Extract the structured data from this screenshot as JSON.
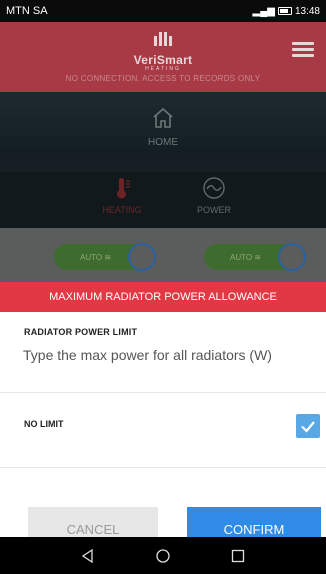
{
  "status_bar": {
    "carrier": "MTN SA",
    "time": "13:48"
  },
  "header": {
    "brand": "VeriSmart",
    "brand_sub": "HEATING",
    "offline_message": "NO CONNECTION. ACCESS TO RECORDS ONLY"
  },
  "nav": {
    "home_label": "HOME",
    "tabs": [
      {
        "label": "HEATING",
        "icon": "thermometer-icon"
      },
      {
        "label": "POWER",
        "icon": "power-wave-icon"
      }
    ]
  },
  "devices": [
    {
      "mode": "AUTO"
    },
    {
      "mode": "AUTO"
    }
  ],
  "dialog": {
    "title": "MAXIMUM RADIATOR POWER ALLOWANCE",
    "field_label": "RADIATOR POWER LIMIT",
    "field_placeholder": "Type the max power for all radiators (W)",
    "field_value": "",
    "no_limit_label": "NO LIMIT",
    "no_limit_checked": true,
    "cancel_label": "CANCEL",
    "confirm_label": "CONFIRM"
  },
  "colors": {
    "header": "#a83a45",
    "dialog_title": "#e13844",
    "confirm": "#2f8be6",
    "checkbox": "#58a8e6"
  }
}
